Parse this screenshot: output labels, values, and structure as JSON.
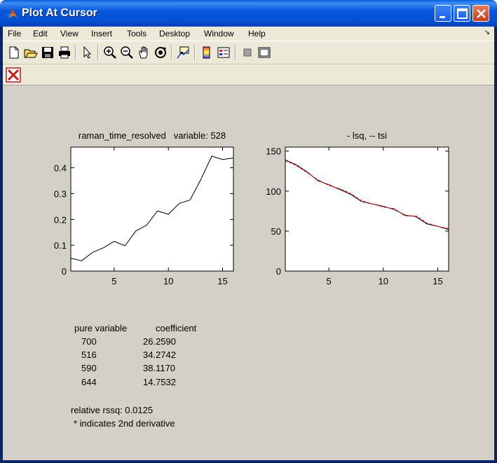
{
  "window": {
    "title": "Plot At Cursor"
  },
  "menubar": {
    "items": [
      "File",
      "Edit",
      "View",
      "Insert",
      "Tools",
      "Desktop",
      "Window",
      "Help"
    ]
  },
  "toolbar": {
    "icons": [
      "new-file-icon",
      "open-folder-icon",
      "save-icon",
      "print-icon",
      "select-arrow-icon",
      "zoom-in-icon",
      "zoom-out-icon",
      "pan-hand-icon",
      "rotate-3d-icon",
      "data-cursor-icon",
      "colorbar-icon",
      "legend-icon",
      "hide-plot-tools-icon",
      "show-plot-tools-icon"
    ]
  },
  "results": {
    "header_variable": "pure variable",
    "header_coefficient": "coefficient",
    "rows": [
      {
        "variable": "700",
        "coefficient": "26.2590"
      },
      {
        "variable": "516",
        "coefficient": "34.2742"
      },
      {
        "variable": "590",
        "coefficient": "38.1170"
      },
      {
        "variable": "644",
        "coefficient": "14.7532"
      }
    ],
    "rssq": "relative rssq: 0.0125",
    "note": "* indicates 2nd derivative"
  },
  "chart_data": [
    {
      "type": "line",
      "title": "raman_time_resolved   variable: 528",
      "xlabel": "",
      "ylabel": "",
      "xlim": [
        1,
        16
      ],
      "ylim": [
        0,
        0.48
      ],
      "xticks": [
        5,
        10,
        15
      ],
      "yticks": [
        0,
        0.1,
        0.2,
        0.3,
        0.4
      ],
      "ytick_labels": [
        "0",
        "0.1",
        "0.2",
        "0.3",
        "0.4"
      ],
      "series": [
        {
          "color": "#000000",
          "x": [
            1,
            2,
            3,
            4,
            5,
            6,
            7,
            8,
            9,
            10,
            11,
            12,
            13,
            14,
            15,
            16
          ],
          "y": [
            0.05,
            0.04,
            0.072,
            0.09,
            0.115,
            0.098,
            0.155,
            0.178,
            0.233,
            0.22,
            0.262,
            0.275,
            0.355,
            0.445,
            0.432,
            0.438
          ]
        }
      ]
    },
    {
      "type": "line",
      "title": "- lsq, -- tsi",
      "xlabel": "",
      "ylabel": "",
      "xlim": [
        1,
        16
      ],
      "ylim": [
        0,
        155
      ],
      "xticks": [
        5,
        10,
        15
      ],
      "yticks": [
        0,
        50,
        100,
        150
      ],
      "ytick_labels": [
        "0",
        "50",
        "100",
        "150"
      ],
      "series": [
        {
          "color": "#000000",
          "style": "solid",
          "x": [
            1,
            2,
            3,
            4,
            5,
            6,
            7,
            8,
            9,
            10,
            11,
            12,
            13,
            14,
            15,
            16
          ],
          "y": [
            139,
            133,
            124,
            113,
            108,
            102,
            96,
            87,
            84,
            81,
            77,
            70,
            68,
            59,
            56,
            52
          ]
        },
        {
          "color": "#ff0000",
          "style": "dashed",
          "x": [
            1,
            2,
            3,
            4,
            5,
            6,
            7,
            8,
            9,
            10,
            11,
            12,
            13,
            14,
            15,
            16
          ],
          "y": [
            138,
            132,
            123,
            114,
            107,
            103,
            97,
            88,
            84,
            80,
            78,
            69,
            69,
            60,
            56,
            53
          ]
        }
      ]
    }
  ]
}
